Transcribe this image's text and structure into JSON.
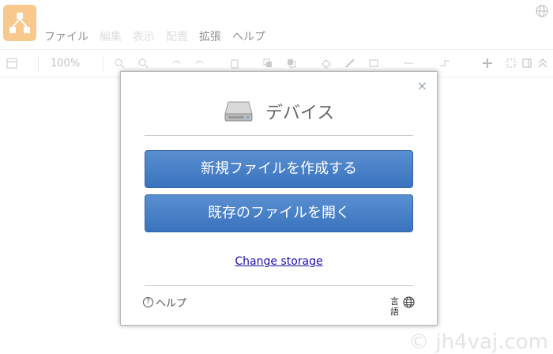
{
  "app": {
    "menu": [
      {
        "label": "ファイル",
        "enabled": true
      },
      {
        "label": "編集",
        "enabled": false
      },
      {
        "label": "表示",
        "enabled": false
      },
      {
        "label": "配置",
        "enabled": false
      },
      {
        "label": "拡張",
        "enabled": true
      },
      {
        "label": "ヘルプ",
        "enabled": true
      }
    ],
    "toolbar": {
      "zoom": "100%"
    }
  },
  "dialog": {
    "close_label": "×",
    "title": "デバイス",
    "new_file_button": "新規ファイルを作成する",
    "open_file_button": "既存のファイルを開く",
    "change_storage_link": "Change storage",
    "help_label": "ヘルプ",
    "help_icon": "?",
    "language_label": "言語"
  },
  "watermark": "© jh4vaj.com",
  "colors": {
    "accent": "#3f78c3",
    "logo": "#f08705"
  }
}
